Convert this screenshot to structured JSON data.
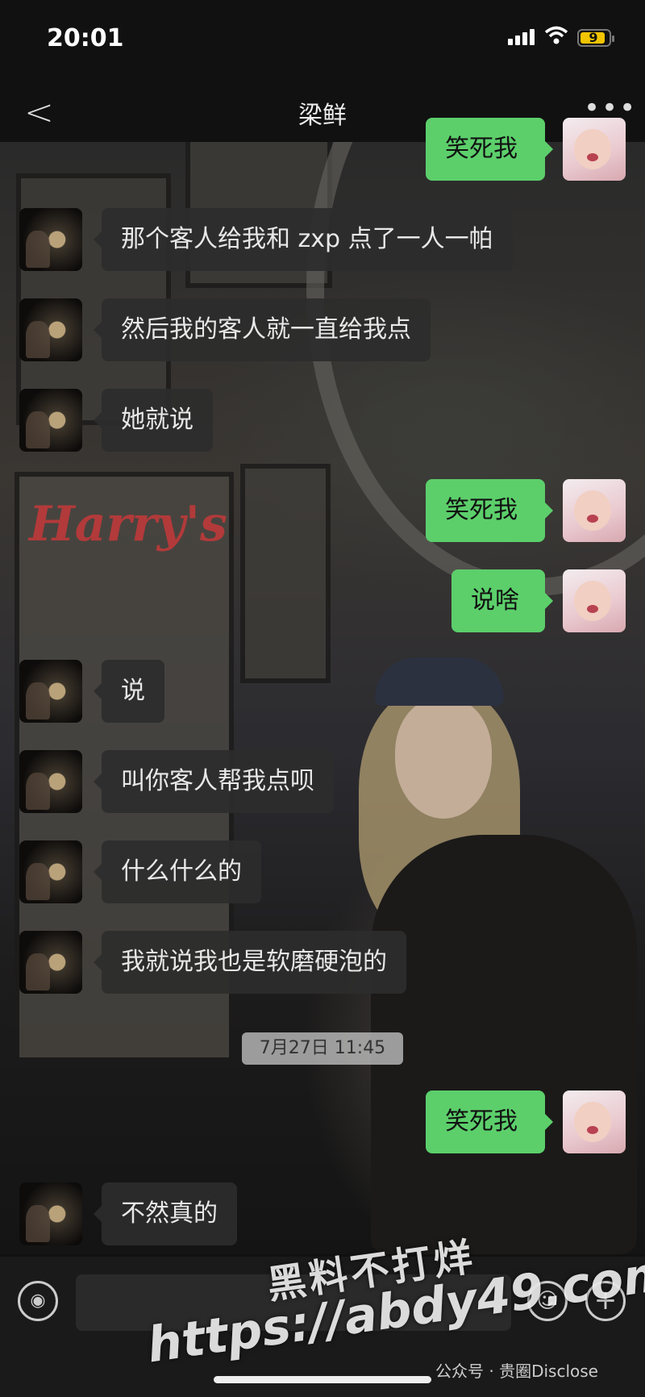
{
  "status": {
    "time": "20:01",
    "battery": "9"
  },
  "nav": {
    "back": "<",
    "title": "梁鲜",
    "more": "•••"
  },
  "messages": [
    {
      "side": "right",
      "text": "笑死我",
      "partial": true
    },
    {
      "side": "left",
      "text": "那个客人给我和 zxp 点了一人一帕"
    },
    {
      "side": "left",
      "text": "然后我的客人就一直给我点"
    },
    {
      "side": "left",
      "text": "她就说"
    },
    {
      "side": "right",
      "text": "笑死我"
    },
    {
      "side": "right",
      "text": "说啥"
    },
    {
      "side": "left",
      "text": "说"
    },
    {
      "side": "left",
      "text": "叫你客人帮我点呗"
    },
    {
      "side": "left",
      "text": "什么什么的"
    },
    {
      "side": "left",
      "text": "我就说我也是软磨硬泡的"
    },
    {
      "side": "right",
      "text": "笑死我"
    },
    {
      "side": "left",
      "text": "不然真的"
    }
  ],
  "timestamp": "7月27日 11:45",
  "inputbar": {
    "voice_icon": "voice-icon",
    "emoji_icon": "emoji-icon",
    "plus_icon": "plus-icon"
  },
  "watermark": {
    "line1": "黑料不打烊",
    "line2": "https://abdy49.com",
    "source": "公众号 · 贵圈Disclose"
  },
  "colors": {
    "bubble_right": "#5ccf6b",
    "bubble_left": "#2c2c2c",
    "battery": "#f2c400"
  }
}
